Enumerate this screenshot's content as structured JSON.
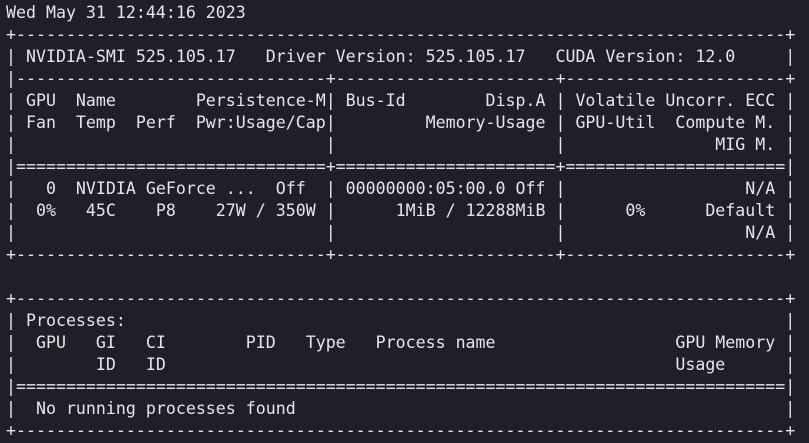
{
  "terminal": {
    "lines": [
      "Wed May 31 12:44:16 2023",
      "+-----------------------------------------------------------------------------+",
      "| NVIDIA-SMI 525.105.17   Driver Version: 525.105.17   CUDA Version: 12.0     |",
      "|-------------------------------+----------------------+----------------------+",
      "| GPU  Name        Persistence-M| Bus-Id        Disp.A | Volatile Uncorr. ECC |",
      "| Fan  Temp  Perf  Pwr:Usage/Cap|         Memory-Usage | GPU-Util  Compute M. |",
      "|                               |                      |               MIG M. |",
      "|===============================+======================+======================|",
      "|   0  NVIDIA GeForce ...  Off  | 00000000:05:00.0 Off |                  N/A |",
      "|  0%   45C    P8    27W / 350W |      1MiB / 12288MiB |      0%      Default |",
      "|                               |                      |                  N/A |",
      "+-------------------------------+----------------------+----------------------+",
      "",
      "+-----------------------------------------------------------------------------+",
      "| Processes:                                                                  |",
      "|  GPU   GI   CI        PID   Type   Process name                  GPU Memory |",
      "|        ID   ID                                                   Usage      |",
      "|=============================================================================|",
      "|  No running processes found                                                 |",
      "+-----------------------------------------------------------------------------+"
    ]
  }
}
